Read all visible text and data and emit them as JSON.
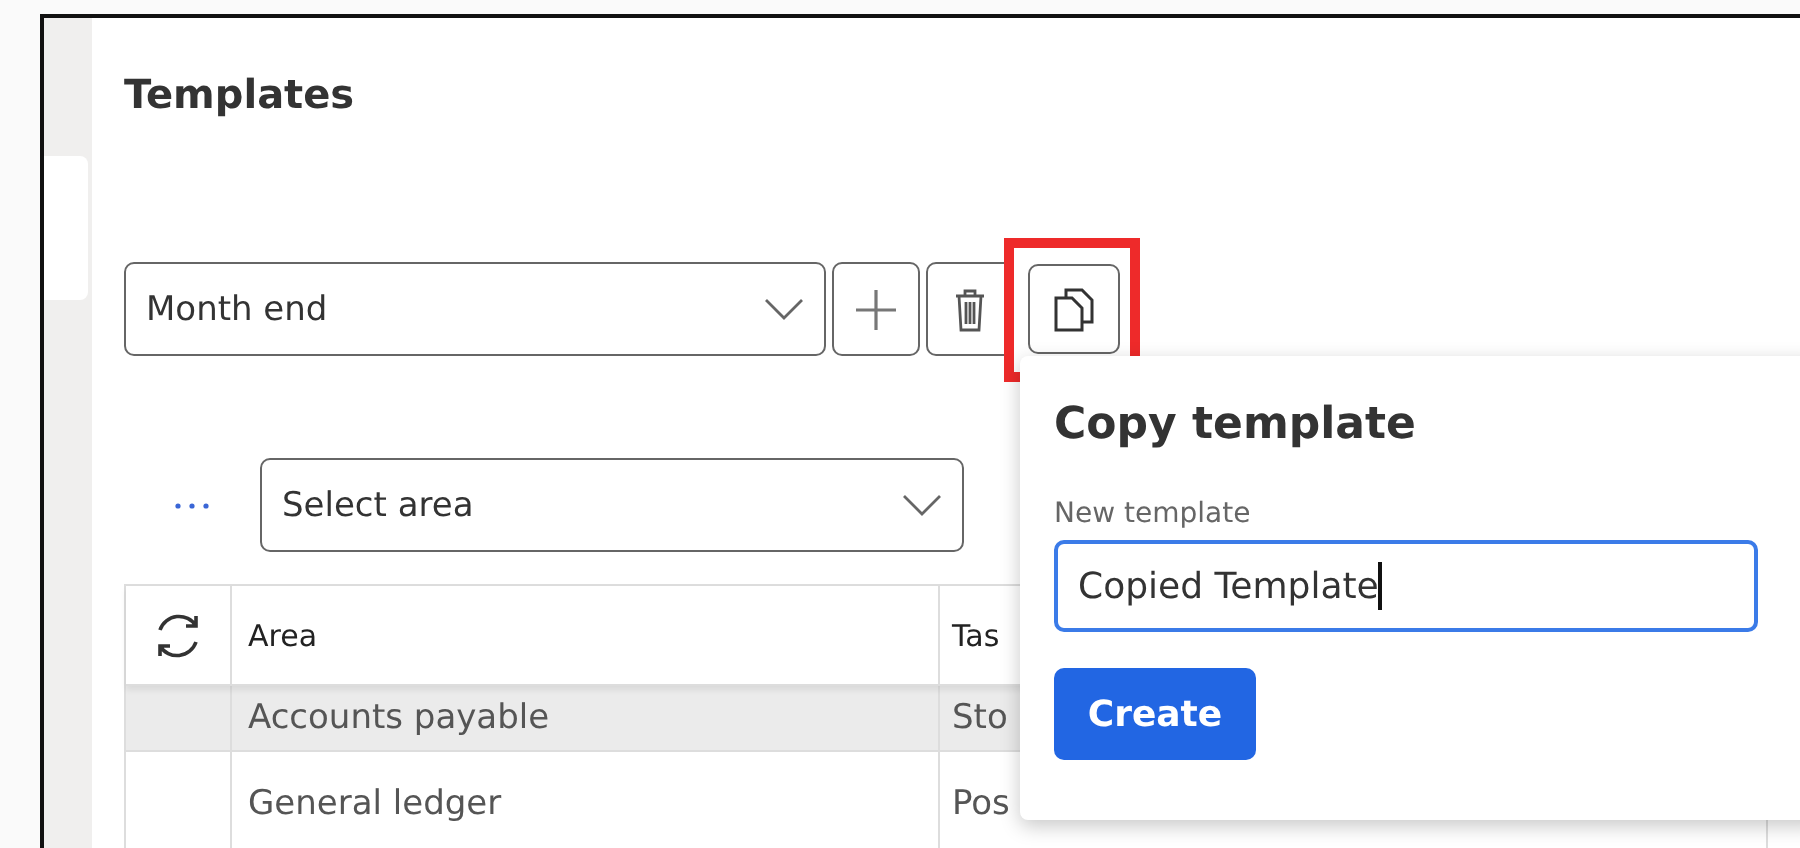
{
  "page": {
    "title": "Templates"
  },
  "template_picker": {
    "value": "Month end"
  },
  "toolbar_buttons": [
    {
      "kind": "add",
      "highlighted": false
    },
    {
      "kind": "delete",
      "highlighted": false
    },
    {
      "kind": "copy",
      "highlighted": true
    }
  ],
  "area_filter": {
    "value": "Select area"
  },
  "table": {
    "columns": [
      {
        "label": "Area"
      },
      {
        "label": "Tas"
      }
    ],
    "rows": [
      {
        "cells": [
          "Accounts payable",
          "Sto"
        ],
        "selected": true
      },
      {
        "cells": [
          "General ledger",
          "Pos"
        ],
        "selected": false
      }
    ]
  },
  "popup": {
    "title": "Copy template",
    "field": {
      "label": "New template",
      "value": "Copied Template",
      "focused": true
    },
    "button": "Create"
  }
}
